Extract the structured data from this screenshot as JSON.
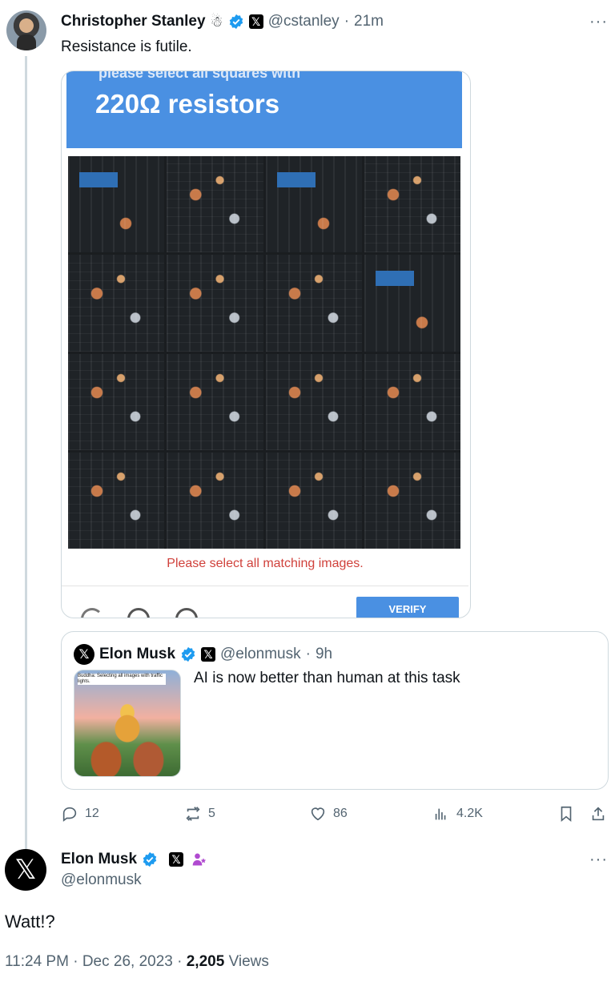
{
  "reply_tweet": {
    "author_name": "Christopher Stanley",
    "emoji": "☃",
    "handle": "@cstanley",
    "time": "21m",
    "more": "···",
    "text": "Resistance is futile.",
    "captcha": {
      "partial_top_text": "please select all squares with",
      "heading": "220Ω resistors",
      "message": "Please select all matching images.",
      "button_label": "VERIFY"
    },
    "quoted_tweet": {
      "author_name": "Elon Musk",
      "handle": "@elonmusk",
      "time": "9h",
      "text": "AI is now better than human at this task",
      "image_caption": "Buddha: Selecting all images with traffic lights."
    },
    "actions": {
      "replies": "12",
      "reposts": "5",
      "likes": "86",
      "views": "4.2K"
    }
  },
  "main_tweet": {
    "author_name": "Elon Musk",
    "handle": "@elonmusk",
    "more": "···",
    "text": "Watt!?",
    "time": "11:24 PM",
    "date": "Dec 26, 2023",
    "views_count": "2,205",
    "views_label": "Views"
  },
  "colors": {
    "verified_blue": "#1d9bf0",
    "captcha_blue": "#4a90e2",
    "captcha_error": "#d0413b",
    "muted_text": "#536471"
  }
}
